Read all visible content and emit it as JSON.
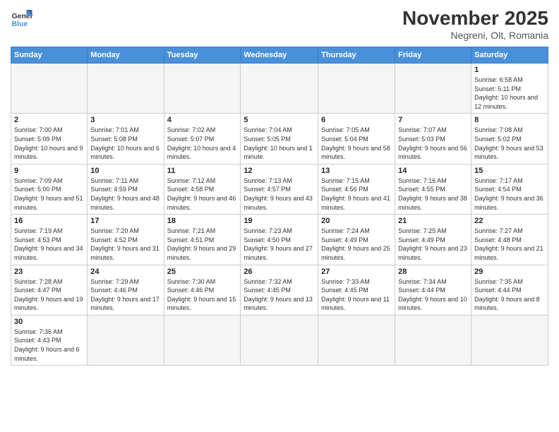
{
  "logo": {
    "line1": "General",
    "line2": "Blue"
  },
  "title": "November 2025",
  "subtitle": "Negreni, Olt, Romania",
  "days_header": [
    "Sunday",
    "Monday",
    "Tuesday",
    "Wednesday",
    "Thursday",
    "Friday",
    "Saturday"
  ],
  "weeks": [
    [
      {
        "day": "",
        "info": ""
      },
      {
        "day": "",
        "info": ""
      },
      {
        "day": "",
        "info": ""
      },
      {
        "day": "",
        "info": ""
      },
      {
        "day": "",
        "info": ""
      },
      {
        "day": "",
        "info": ""
      },
      {
        "day": "1",
        "info": "Sunrise: 6:58 AM\nSunset: 5:11 PM\nDaylight: 10 hours\nand 12 minutes."
      }
    ],
    [
      {
        "day": "2",
        "info": "Sunrise: 7:00 AM\nSunset: 5:09 PM\nDaylight: 10 hours\nand 9 minutes."
      },
      {
        "day": "3",
        "info": "Sunrise: 7:01 AM\nSunset: 5:08 PM\nDaylight: 10 hours\nand 6 minutes."
      },
      {
        "day": "4",
        "info": "Sunrise: 7:02 AM\nSunset: 5:07 PM\nDaylight: 10 hours\nand 4 minutes."
      },
      {
        "day": "5",
        "info": "Sunrise: 7:04 AM\nSunset: 5:05 PM\nDaylight: 10 hours\nand 1 minute."
      },
      {
        "day": "6",
        "info": "Sunrise: 7:05 AM\nSunset: 5:04 PM\nDaylight: 9 hours\nand 58 minutes."
      },
      {
        "day": "7",
        "info": "Sunrise: 7:07 AM\nSunset: 5:03 PM\nDaylight: 9 hours\nand 56 minutes."
      },
      {
        "day": "8",
        "info": "Sunrise: 7:08 AM\nSunset: 5:02 PM\nDaylight: 9 hours\nand 53 minutes."
      }
    ],
    [
      {
        "day": "9",
        "info": "Sunrise: 7:09 AM\nSunset: 5:00 PM\nDaylight: 9 hours\nand 51 minutes."
      },
      {
        "day": "10",
        "info": "Sunrise: 7:11 AM\nSunset: 4:59 PM\nDaylight: 9 hours\nand 48 minutes."
      },
      {
        "day": "11",
        "info": "Sunrise: 7:12 AM\nSunset: 4:58 PM\nDaylight: 9 hours\nand 46 minutes."
      },
      {
        "day": "12",
        "info": "Sunrise: 7:13 AM\nSunset: 4:57 PM\nDaylight: 9 hours\nand 43 minutes."
      },
      {
        "day": "13",
        "info": "Sunrise: 7:15 AM\nSunset: 4:56 PM\nDaylight: 9 hours\nand 41 minutes."
      },
      {
        "day": "14",
        "info": "Sunrise: 7:16 AM\nSunset: 4:55 PM\nDaylight: 9 hours\nand 38 minutes."
      },
      {
        "day": "15",
        "info": "Sunrise: 7:17 AM\nSunset: 4:54 PM\nDaylight: 9 hours\nand 36 minutes."
      }
    ],
    [
      {
        "day": "16",
        "info": "Sunrise: 7:19 AM\nSunset: 4:53 PM\nDaylight: 9 hours\nand 34 minutes."
      },
      {
        "day": "17",
        "info": "Sunrise: 7:20 AM\nSunset: 4:52 PM\nDaylight: 9 hours\nand 31 minutes."
      },
      {
        "day": "18",
        "info": "Sunrise: 7:21 AM\nSunset: 4:51 PM\nDaylight: 9 hours\nand 29 minutes."
      },
      {
        "day": "19",
        "info": "Sunrise: 7:23 AM\nSunset: 4:50 PM\nDaylight: 9 hours\nand 27 minutes."
      },
      {
        "day": "20",
        "info": "Sunrise: 7:24 AM\nSunset: 4:49 PM\nDaylight: 9 hours\nand 25 minutes."
      },
      {
        "day": "21",
        "info": "Sunrise: 7:25 AM\nSunset: 4:49 PM\nDaylight: 9 hours\nand 23 minutes."
      },
      {
        "day": "22",
        "info": "Sunrise: 7:27 AM\nSunset: 4:48 PM\nDaylight: 9 hours\nand 21 minutes."
      }
    ],
    [
      {
        "day": "23",
        "info": "Sunrise: 7:28 AM\nSunset: 4:47 PM\nDaylight: 9 hours\nand 19 minutes."
      },
      {
        "day": "24",
        "info": "Sunrise: 7:29 AM\nSunset: 4:46 PM\nDaylight: 9 hours\nand 17 minutes."
      },
      {
        "day": "25",
        "info": "Sunrise: 7:30 AM\nSunset: 4:46 PM\nDaylight: 9 hours\nand 15 minutes."
      },
      {
        "day": "26",
        "info": "Sunrise: 7:32 AM\nSunset: 4:45 PM\nDaylight: 9 hours\nand 13 minutes."
      },
      {
        "day": "27",
        "info": "Sunrise: 7:33 AM\nSunset: 4:45 PM\nDaylight: 9 hours\nand 11 minutes."
      },
      {
        "day": "28",
        "info": "Sunrise: 7:34 AM\nSunset: 4:44 PM\nDaylight: 9 hours\nand 10 minutes."
      },
      {
        "day": "29",
        "info": "Sunrise: 7:35 AM\nSunset: 4:44 PM\nDaylight: 9 hours\nand 8 minutes."
      }
    ],
    [
      {
        "day": "30",
        "info": "Sunrise: 7:36 AM\nSunset: 4:43 PM\nDaylight: 9 hours\nand 6 minutes."
      },
      {
        "day": "",
        "info": ""
      },
      {
        "day": "",
        "info": ""
      },
      {
        "day": "",
        "info": ""
      },
      {
        "day": "",
        "info": ""
      },
      {
        "day": "",
        "info": ""
      },
      {
        "day": "",
        "info": ""
      }
    ]
  ]
}
